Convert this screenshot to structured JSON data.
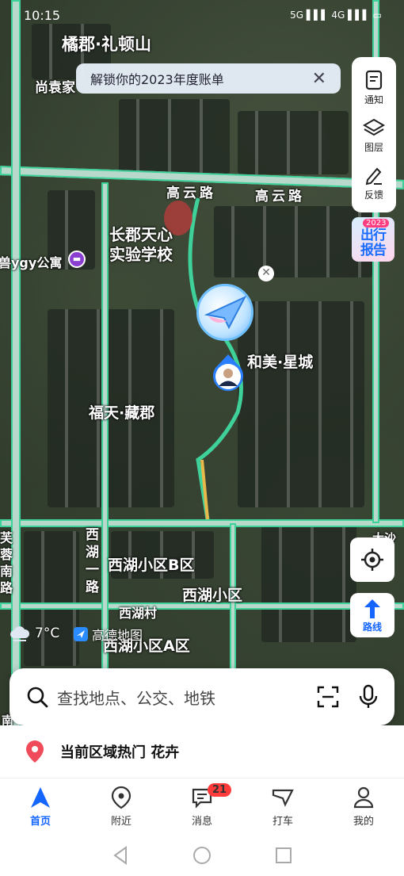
{
  "status": {
    "time": "10:15",
    "icons_text": "5G ▌▌▌ 4G ▌▌▌ ▭"
  },
  "map": {
    "labels": {
      "juju": "橘郡·礼顿山",
      "shangyuan": "尚袁家",
      "gaoyun1": "高云路",
      "gaoyun2": "高云路",
      "school": "长郡天心\n实验学校",
      "hotel": "兽ygy公寓",
      "hemei": "和美·星城",
      "futian": "福天·藏郡",
      "xihulu": "西\n湖\n一\n路",
      "xihub": "西湖小区B区",
      "xihuxq": "西湖小区",
      "xihucun": "西湖村",
      "xihua": "西湖小区A区",
      "furong": "芙\n蓉\n南\n路",
      "dashashi": "大沙",
      "nan": "南"
    }
  },
  "banner": {
    "text": "解锁你的2023年度账单"
  },
  "side": {
    "notify": "通知",
    "layers": "图层",
    "feedback": "反馈"
  },
  "report": {
    "year": "2023",
    "text": "出行\n报告"
  },
  "route_label": "路线",
  "weather": {
    "temp": "7°C"
  },
  "logo": {
    "text": "高德地图"
  },
  "search": {
    "placeholder": "查找地点、公交、地铁"
  },
  "hot": {
    "text": "当前区域热门 花卉"
  },
  "tabs": [
    {
      "label": "首页"
    },
    {
      "label": "附近"
    },
    {
      "label": "消息",
      "badge": "21"
    },
    {
      "label": "打车"
    },
    {
      "label": "我的"
    }
  ],
  "colors": {
    "accent": "#1565ff",
    "road": "#3fd19a",
    "badge": "#ff3b3b"
  }
}
